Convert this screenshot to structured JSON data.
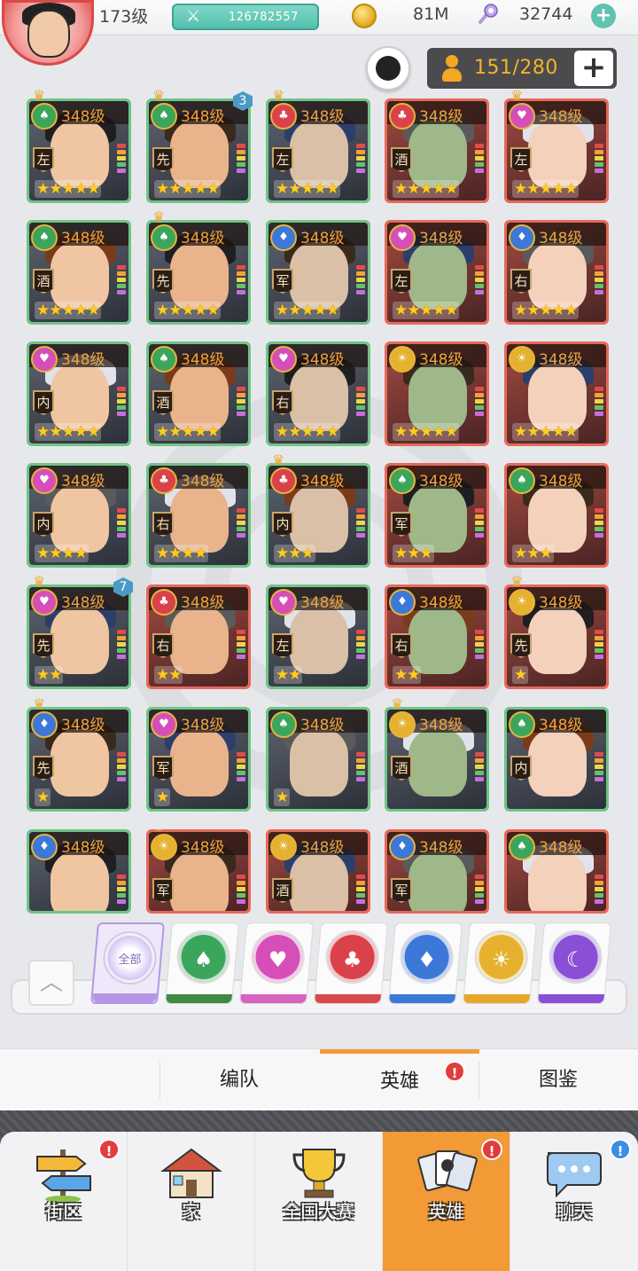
{
  "header": {
    "player_level": "173级",
    "power": "126782557",
    "gold": "81M",
    "gems": "32744"
  },
  "roster": {
    "count": "151/280"
  },
  "heroes": [
    {
      "level": "348级",
      "faction": "green",
      "pos": "左",
      "stars": "★★★★★",
      "border": "green",
      "crown": true
    },
    {
      "level": "348级",
      "faction": "green",
      "pos": "先",
      "stars": "★★★★★",
      "border": "green",
      "crown": true,
      "badge": "3"
    },
    {
      "level": "348级",
      "faction": "red",
      "pos": "左",
      "stars": "★★★★★",
      "border": "green",
      "crown": true
    },
    {
      "level": "348级",
      "faction": "red",
      "pos": "酒",
      "stars": "★★★★★",
      "border": "red",
      "crown": false
    },
    {
      "level": "348级",
      "faction": "pink",
      "pos": "左",
      "stars": "★★★★★",
      "border": "red",
      "crown": true
    },
    {
      "level": "348级",
      "faction": "green",
      "pos": "酒",
      "stars": "★★★★★",
      "border": "green",
      "crown": false
    },
    {
      "level": "348级",
      "faction": "green",
      "pos": "先",
      "stars": "★★★★★",
      "border": "green",
      "crown": true
    },
    {
      "level": "348级",
      "faction": "blue",
      "pos": "军",
      "stars": "★★★★★",
      "border": "green",
      "crown": false
    },
    {
      "level": "348级",
      "faction": "pink",
      "pos": "左",
      "stars": "★★★★★",
      "border": "red",
      "crown": false
    },
    {
      "level": "348级",
      "faction": "blue",
      "pos": "右",
      "stars": "★★★★★",
      "border": "red",
      "crown": false
    },
    {
      "level": "348级",
      "faction": "pink",
      "pos": "内",
      "stars": "★★★★★",
      "border": "green",
      "crown": false
    },
    {
      "level": "348级",
      "faction": "green",
      "pos": "酒",
      "stars": "★★★★★",
      "border": "green",
      "crown": false
    },
    {
      "level": "348级",
      "faction": "pink",
      "pos": "右",
      "stars": "★★★★★",
      "border": "green",
      "crown": false
    },
    {
      "level": "348级",
      "faction": "gold",
      "pos": "",
      "stars": "★★★★★",
      "border": "red",
      "crown": false
    },
    {
      "level": "348级",
      "faction": "gold",
      "pos": "",
      "stars": "★★★★★",
      "border": "red",
      "crown": false
    },
    {
      "level": "348级",
      "faction": "pink",
      "pos": "内",
      "stars": "★★★★",
      "border": "green",
      "crown": false
    },
    {
      "level": "348级",
      "faction": "red",
      "pos": "右",
      "stars": "★★★★",
      "border": "green",
      "crown": false
    },
    {
      "level": "348级",
      "faction": "red",
      "pos": "内",
      "stars": "★★★",
      "border": "green",
      "crown": true
    },
    {
      "level": "348级",
      "faction": "green",
      "pos": "军",
      "stars": "★★★",
      "border": "red",
      "crown": false
    },
    {
      "level": "348级",
      "faction": "green",
      "pos": "",
      "stars": "★★★",
      "border": "red",
      "crown": false
    },
    {
      "level": "348级",
      "faction": "pink",
      "pos": "先",
      "stars": "★★",
      "border": "green",
      "crown": true,
      "badge": "7"
    },
    {
      "level": "348级",
      "faction": "red",
      "pos": "右",
      "stars": "★★",
      "border": "red",
      "crown": false
    },
    {
      "level": "348级",
      "faction": "pink",
      "pos": "左",
      "stars": "★★",
      "border": "green",
      "crown": false
    },
    {
      "level": "348级",
      "faction": "blue",
      "pos": "右",
      "stars": "★★",
      "border": "red",
      "crown": false
    },
    {
      "level": "348级",
      "faction": "gold",
      "pos": "先",
      "stars": "★",
      "border": "red",
      "crown": true
    },
    {
      "level": "348级",
      "faction": "blue",
      "pos": "先",
      "stars": "★",
      "border": "green",
      "crown": true
    },
    {
      "level": "348级",
      "faction": "pink",
      "pos": "军",
      "stars": "★",
      "border": "green",
      "crown": false
    },
    {
      "level": "348级",
      "faction": "green",
      "pos": "",
      "stars": "★",
      "border": "green",
      "crown": false
    },
    {
      "level": "348级",
      "faction": "gold",
      "pos": "酒",
      "stars": "",
      "border": "green",
      "crown": true
    },
    {
      "level": "348级",
      "faction": "green",
      "pos": "内",
      "stars": "",
      "border": "green",
      "crown": false
    },
    {
      "level": "348级",
      "faction": "blue",
      "pos": "",
      "stars": "",
      "border": "green",
      "crown": false
    },
    {
      "level": "348级",
      "faction": "gold",
      "pos": "军",
      "stars": "",
      "border": "red",
      "crown": true
    },
    {
      "level": "348级",
      "faction": "gold",
      "pos": "酒",
      "stars": "",
      "border": "red",
      "crown": false
    },
    {
      "level": "348级",
      "faction": "blue",
      "pos": "军",
      "stars": "",
      "border": "red",
      "crown": false
    },
    {
      "level": "348级",
      "faction": "green",
      "pos": "",
      "stars": "",
      "border": "red",
      "crown": false
    }
  ],
  "faction_colors": {
    "green": "#3ba55c",
    "red": "#d9424a",
    "pink": "#d64fb8",
    "blue": "#3c78d8",
    "gold": "#e6b12e",
    "purple": "#8a4fd6",
    "all": "#b7a4ee"
  },
  "filters": [
    {
      "key": "all",
      "label": "全部",
      "stripe": "#b597e6"
    },
    {
      "key": "green",
      "label": "♠",
      "stripe": "#3f8a43"
    },
    {
      "key": "pink",
      "label": "♥",
      "stripe": "#d764c1"
    },
    {
      "key": "red",
      "label": "♣",
      "stripe": "#d84a4a"
    },
    {
      "key": "blue",
      "label": "♦",
      "stripe": "#3c78d8"
    },
    {
      "key": "gold",
      "label": "☀",
      "stripe": "#e9a72a"
    },
    {
      "key": "purple",
      "label": "☾",
      "stripe": "#8a4fd6"
    }
  ],
  "subtabs": [
    {
      "label": "编队"
    },
    {
      "label": "英雄",
      "active": true,
      "alert": "!"
    },
    {
      "label": "图鉴"
    }
  ],
  "nav": [
    {
      "label": "街区",
      "icon": "signpost-icon",
      "alert": "!"
    },
    {
      "label": "家",
      "icon": "house-icon"
    },
    {
      "label": "全国大赛",
      "icon": "trophy-icon"
    },
    {
      "label": "英雄",
      "icon": "hero-cards-icon",
      "active": true,
      "alert": "!"
    },
    {
      "label": "聊天",
      "icon": "chat-bubble-icon",
      "alert": "!",
      "alert_color": "blue"
    }
  ]
}
